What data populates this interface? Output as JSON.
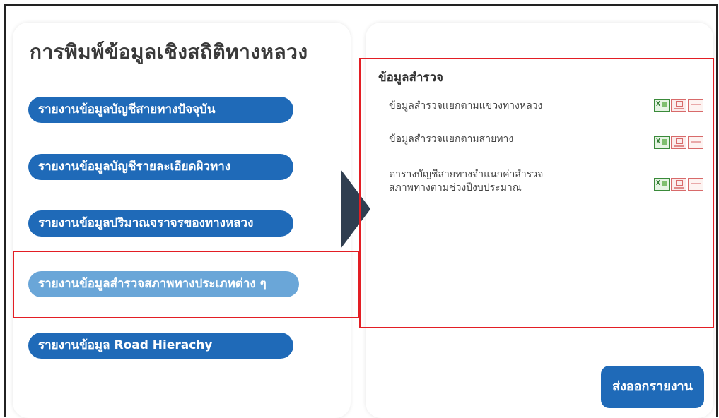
{
  "page": {
    "title": "การพิมพ์ข้อมูลเชิงสถิติทางหลวง"
  },
  "menu": [
    {
      "label": "รายงานข้อมูลบัญชีสายทางปัจจุบัน",
      "active": false
    },
    {
      "label": "รายงานข้อมูลบัญชีรายละเอียดผิวทาง",
      "active": false
    },
    {
      "label": "รายงานข้อมูลปริมาณจราจรของทางหลวง",
      "active": false
    },
    {
      "label": "รายงานข้อมูลสำรวจสภาพทางประเภทต่าง ๆ",
      "active": true
    },
    {
      "label": "รายงานข้อมูล Road Hierachy",
      "active": false
    }
  ],
  "survey": {
    "title": "ข้อมูลสำรวจ",
    "items": [
      {
        "label": "ข้อมูลสำรวจแยกตามแขวงทางหลวง",
        "icons": [
          "xls-icon",
          "pdf-icon",
          "other-icon"
        ]
      },
      {
        "label": "ข้อมูลสำรวจแยกตามสายทาง",
        "icons": [
          "xls-icon",
          "pdf-icon",
          "other-icon"
        ]
      },
      {
        "label_line1": "ตารางบัญชีสายทางจำแนกค่าสำรวจ",
        "label_line2": "สภาพทางตามช่วงปีงบประมาณ",
        "icons": [
          "xls-icon",
          "pdf-icon",
          "other-icon"
        ]
      }
    ]
  },
  "actions": {
    "export_label": "ส่งออกรายงาน"
  },
  "colors": {
    "button_blue": "#1f6ab8",
    "button_active": "#6aa6d8",
    "highlight_red": "#e31e24",
    "arrow": "#2f3e50"
  }
}
